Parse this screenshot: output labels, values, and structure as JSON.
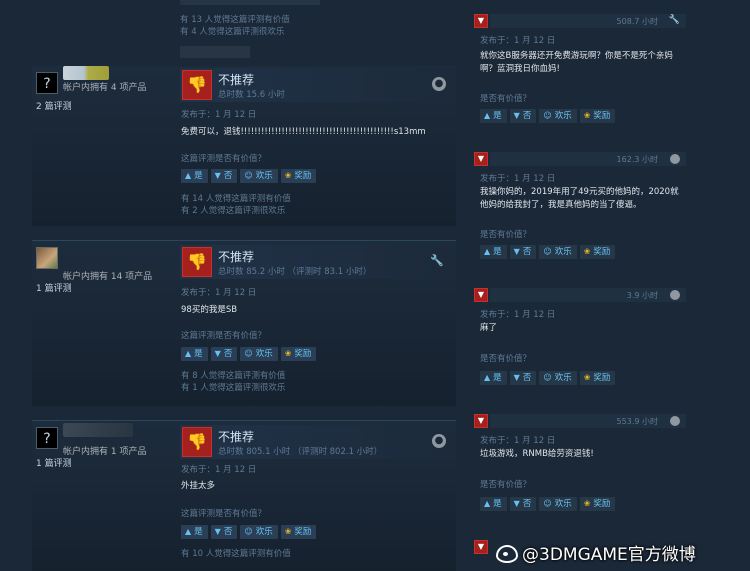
{
  "left": {
    "top_meta": [
      "有 13 人觉得这篇评测有价值",
      "有 4 人觉得这篇评测很欢乐"
    ],
    "reviews": [
      {
        "owns": "帐户内拥有 4 项产品",
        "count": "2 篇评测",
        "verdict": "不推荐",
        "hours": "总时数 15.6 小时",
        "posted": "发布于：1 月 12 日",
        "text": "免费可以，退钱!!!!!!!!!!!!!!!!!!!!!!!!!!!!!!!!!!!!!!!!!!!!!s13mm",
        "help_q": "这篇评测是否有价值？",
        "meta": [
          "有 14 人觉得这篇评测有价值",
          "有 2 人觉得这篇评测很欢乐"
        ]
      },
      {
        "owns": "帐户内拥有 14 项产品",
        "count": "1 篇评测",
        "verdict": "不推荐",
        "hours": "总时数 85.2 小时 （评测时 83.1 小时）",
        "posted": "发布于：1 月 12 日",
        "text": "98买的我是SB",
        "help_q": "这篇评测是否有价值？",
        "meta": [
          "有 8 人觉得这篇评测有价值",
          "有 1 人觉得这篇评测很欢乐"
        ]
      },
      {
        "owns": "帐户内拥有 1 项产品",
        "count": "1 篇评测",
        "verdict": "不推荐",
        "hours": "总时数 805.1 小时 （评测时 802.1 小时）",
        "posted": "发布于：1 月 12 日",
        "text": "外挂太多",
        "help_q": "这篇评测是否有价值？",
        "meta": [
          "有 10 人觉得这篇评测有价值"
        ]
      }
    ]
  },
  "buttons": {
    "yes": "是",
    "no": "否",
    "funny": "欢乐",
    "award": "奖励"
  },
  "right": {
    "comments": [
      {
        "hours": "508.7 小时",
        "posted": "发布于：1 月 12 日",
        "text": "就你这B服务器还开免费游玩啊？你是不是死个亲妈啊？蓝洞我日你血妈!",
        "help_q": "是否有价值？"
      },
      {
        "hours": "162.3 小时",
        "posted": "发布于：1 月 12 日",
        "text": "我操你妈的，2019年用了49元买的他妈的，2020就他妈的给我封了，我是真他妈的当了傻逼。",
        "help_q": "是否有价值？"
      },
      {
        "hours": "3.9 小时",
        "posted": "发布于：1 月 12 日",
        "text": "麻了",
        "help_q": "是否有价值？"
      },
      {
        "hours": "553.9 小时",
        "posted": "发布于：1 月 12 日",
        "text": "垃圾游戏，RNMB给劳资退钱!",
        "help_q": "是否有价值？"
      }
    ]
  },
  "watermark": "@3DMGAME官方微博"
}
